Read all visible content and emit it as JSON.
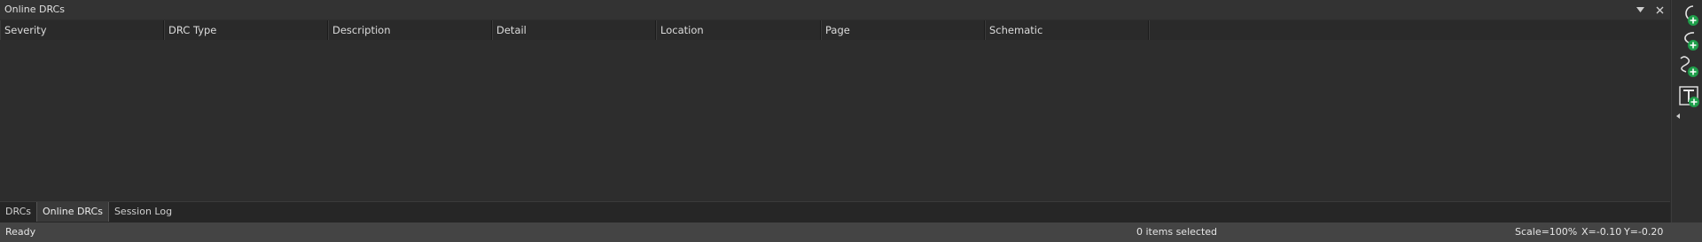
{
  "panel": {
    "title": "Online DRCs",
    "columns": [
      "Severity",
      "DRC Type",
      "Description",
      "Detail",
      "Location",
      "Page",
      "Schematic"
    ]
  },
  "bottom_tabs": [
    {
      "label": "DRCs",
      "active": false
    },
    {
      "label": "Online DRCs",
      "active": true
    },
    {
      "label": "Session Log",
      "active": false
    }
  ],
  "status": {
    "ready": "Ready",
    "selection": "0 items selected",
    "scale": "Scale=100%",
    "x": "X=-0.10",
    "y": "Y=-0.20"
  },
  "tools": [
    "add-arc-icon",
    "add-ellipse-arc-icon",
    "add-bezier-icon",
    "add-text-icon"
  ],
  "colors": {
    "accent_plus": "#1e9e4a"
  }
}
